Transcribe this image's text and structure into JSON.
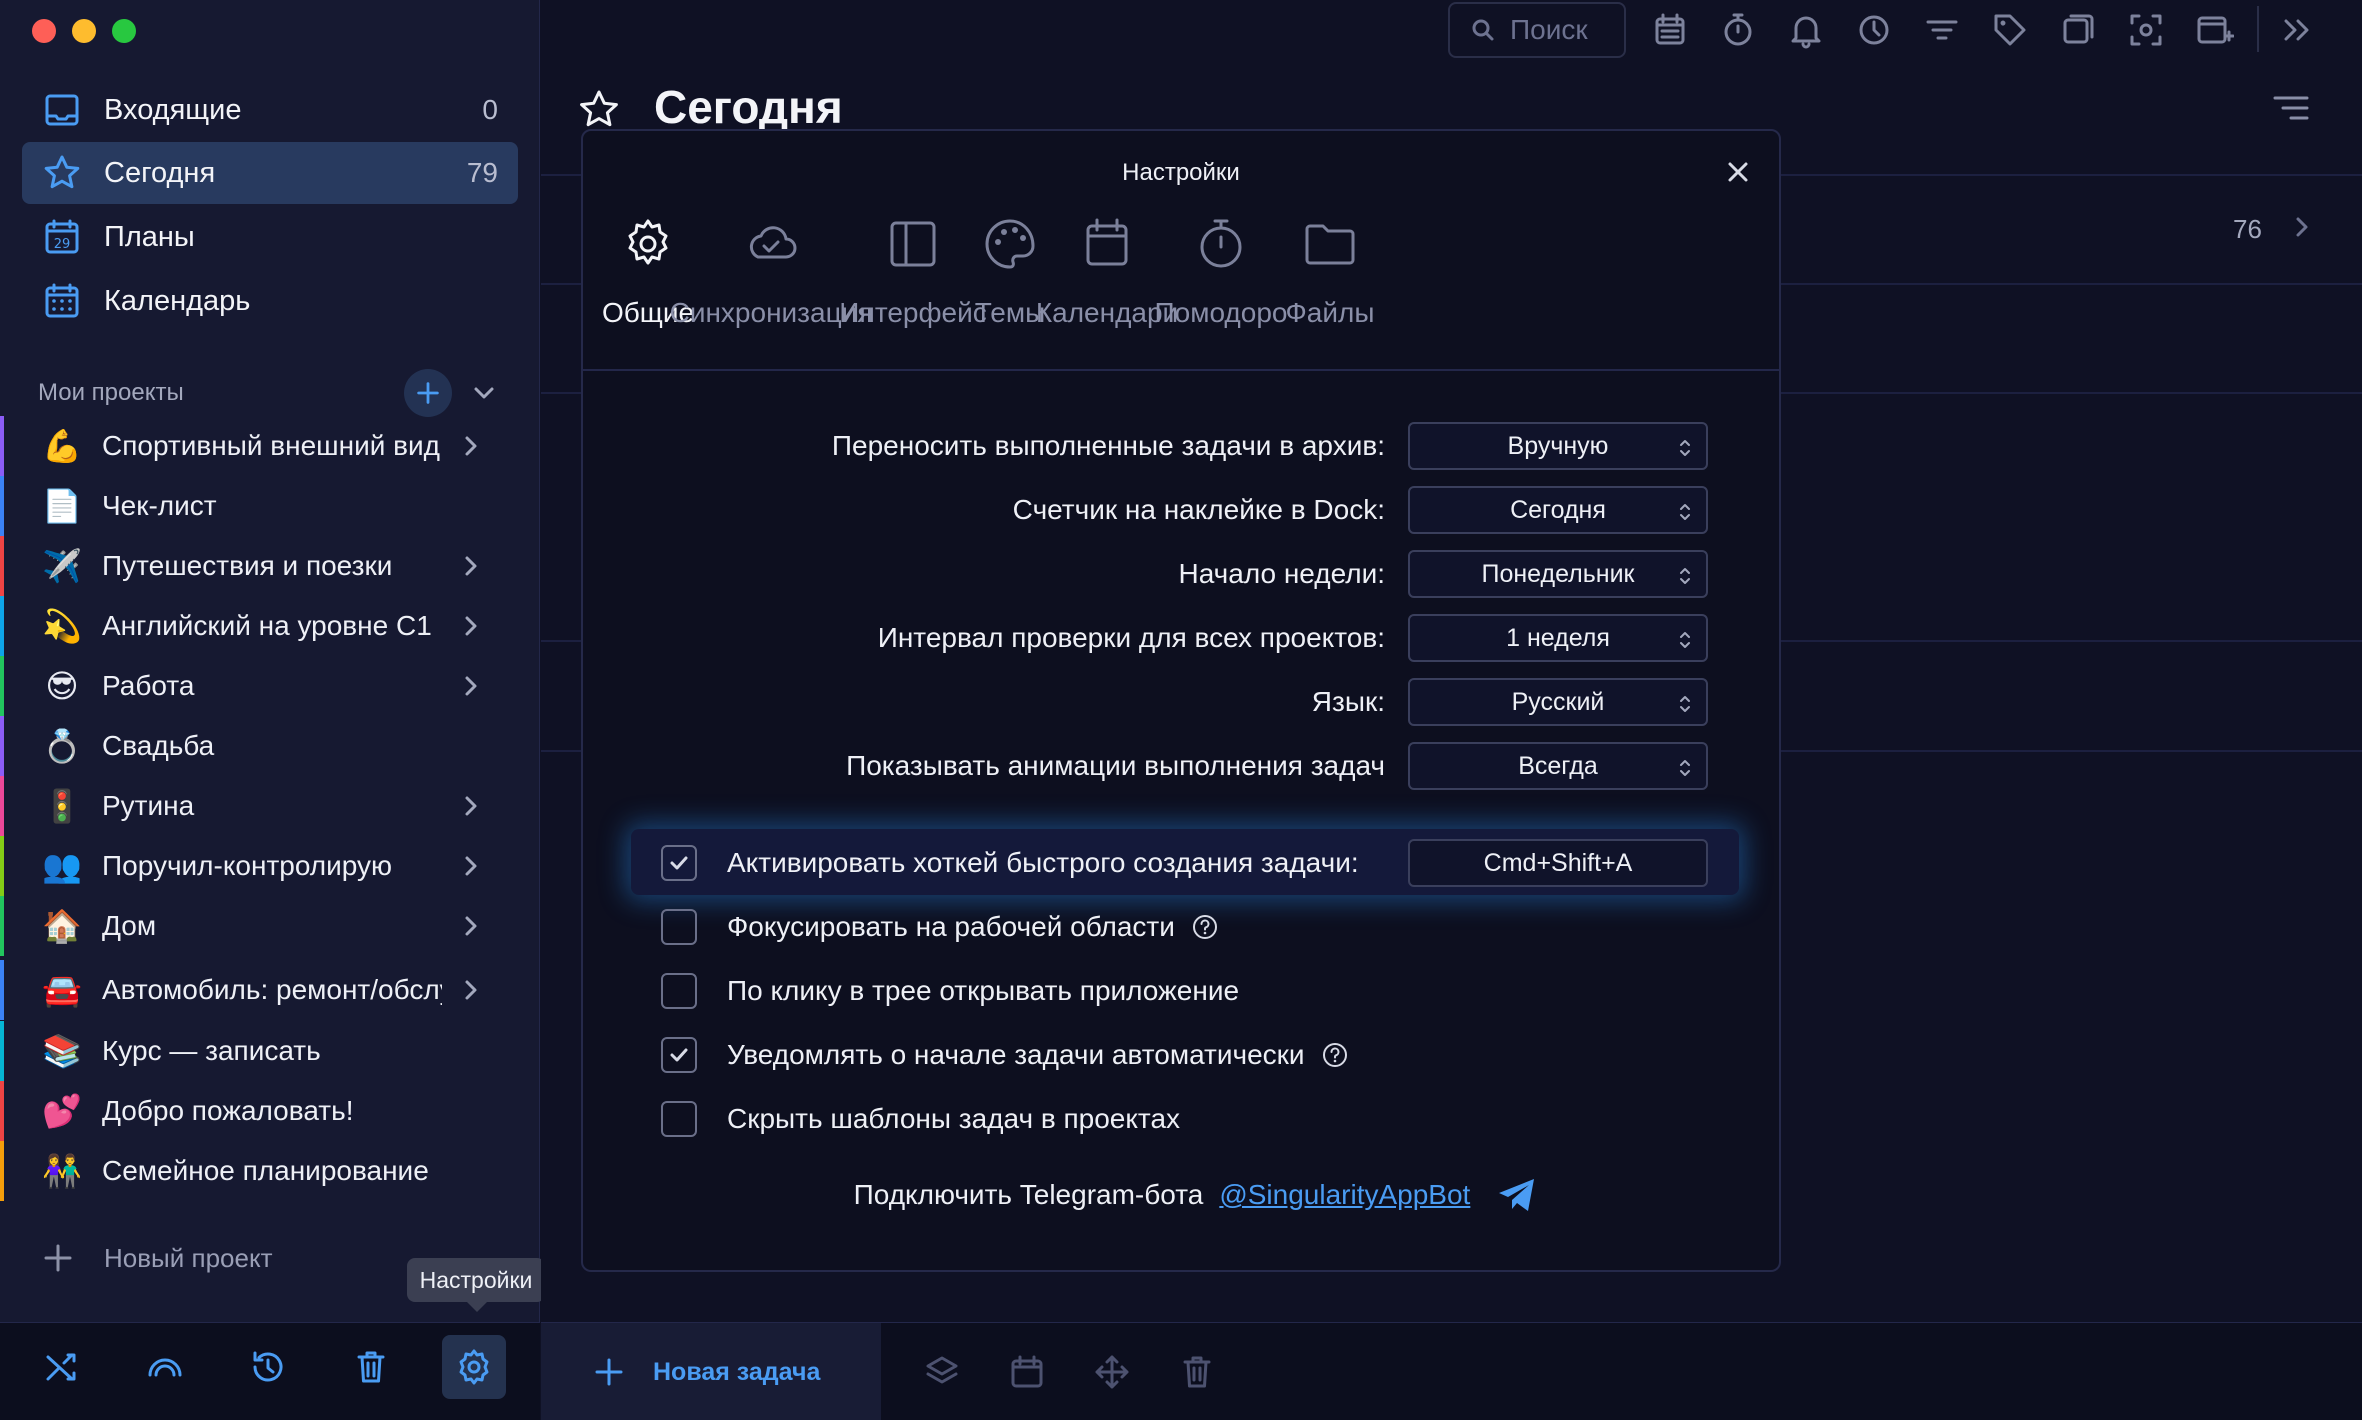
{
  "sidebar": {
    "nav": [
      {
        "label": "Входящие",
        "count": "0",
        "icon": "inbox-icon"
      },
      {
        "label": "Сегодня",
        "count": "79",
        "icon": "star-icon"
      },
      {
        "label": "Планы",
        "count": "",
        "icon": "calendar-29-icon"
      },
      {
        "label": "Календарь",
        "count": "",
        "icon": "calendar-grid-icon"
      }
    ],
    "projects_header": "Мои проекты",
    "projects": [
      {
        "emoji": "💪",
        "label": "Спортивный внешний вид",
        "color": "#8b5cf6",
        "has_children": true
      },
      {
        "emoji": "📄",
        "label": "Чек-лист",
        "color": "#3b82f6",
        "has_children": false
      },
      {
        "emoji": "✈️",
        "label": "Путешествия и поезки",
        "color": "#ef4444",
        "has_children": true
      },
      {
        "emoji": "💫",
        "label": "Английский на уровне С1",
        "color": "#0ea5e9",
        "has_children": true
      },
      {
        "emoji": "😎",
        "label": "Работа",
        "color": "#22c55e",
        "has_children": true
      },
      {
        "emoji": "💍",
        "label": "Свадьба",
        "color": "#8b5cf6",
        "has_children": false
      },
      {
        "emoji": "🚦",
        "label": "Рутина",
        "color": "#ec4899",
        "has_children": true
      },
      {
        "emoji": "👥",
        "label": "Поручил-контролирую",
        "color": "#84cc16",
        "has_children": true
      },
      {
        "emoji": "🏠",
        "label": "Дом",
        "color": "#22c55e",
        "has_children": true
      },
      {
        "emoji": "🚘",
        "label": "Автомобиль: ремонт/обслуживание",
        "color": "#3b82f6",
        "has_children": true
      },
      {
        "emoji": "📚",
        "label": "Курс — записать",
        "color": "#06b6d4",
        "has_children": false
      },
      {
        "emoji": "💕",
        "label": "Добро пожаловать!",
        "color": "#ef4444",
        "has_children": false
      },
      {
        "emoji": "👫",
        "label": "Семейное планирование",
        "color": "#f59e0b",
        "has_children": false
      }
    ],
    "new_project": "Новый проект",
    "tooltip": "Настройки"
  },
  "toolbar": {
    "search_placeholder": "Поиск"
  },
  "main": {
    "title": "Сегодня",
    "row_count": "76",
    "new_task": "Новая задача"
  },
  "settings": {
    "title": "Настройки",
    "tabs": [
      {
        "label": "Общие",
        "icon": "gear-icon",
        "active": true
      },
      {
        "label": "Синхронизация",
        "icon": "cloud-check-icon",
        "active": false
      },
      {
        "label": "Интерфейс",
        "icon": "sidebar-layout-icon",
        "active": false
      },
      {
        "label": "Темы",
        "icon": "palette-icon",
        "active": false
      },
      {
        "label": "Календари",
        "icon": "calendar-icon",
        "active": false
      },
      {
        "label": "Помодоро",
        "icon": "stopwatch-icon",
        "active": false
      },
      {
        "label": "Файлы",
        "icon": "folder-icon",
        "active": false
      }
    ],
    "selects": [
      {
        "label": "Переносить выполненные задачи в архив:",
        "value": "Вручную"
      },
      {
        "label": "Счетчик на наклейке в Dock:",
        "value": "Сегодня"
      },
      {
        "label": "Начало недели:",
        "value": "Понедельник"
      },
      {
        "label": "Интервал проверки для всех проектов:",
        "value": "1 неделя"
      },
      {
        "label": "Язык:",
        "value": "Русский"
      },
      {
        "label": "Показывать анимации выполнения задач",
        "value": "Всегда"
      }
    ],
    "hotkey": {
      "label": "Активировать хоткей быстрого создания задачи:",
      "value": "Cmd+Shift+A",
      "checked": true
    },
    "checkboxes": [
      {
        "label": "Фокусировать на рабочей области",
        "checked": false,
        "help": true
      },
      {
        "label": "По клику в трее открывать приложение",
        "checked": false,
        "help": false
      },
      {
        "label": "Уведомлять о начале задачи автоматически",
        "checked": true,
        "help": true
      },
      {
        "label": "Скрыть шаблоны задач в проектах",
        "checked": false,
        "help": false
      }
    ],
    "telegram": {
      "label": "Подключить Telegram-бота",
      "link": "@SingularityAppBot"
    }
  },
  "colors": {
    "accent": "#4a9cf3",
    "sidebar_bg": "#161931",
    "main_bg": "#0f1124",
    "active_item": "#283a5f"
  }
}
